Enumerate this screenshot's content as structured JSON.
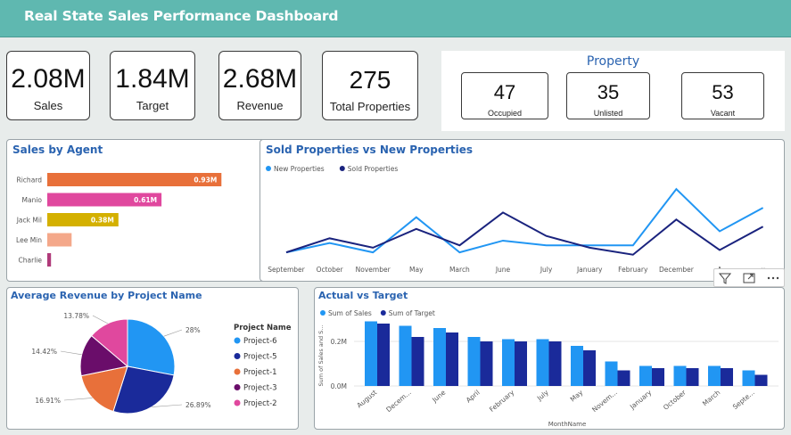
{
  "header": {
    "title": "Real State Sales Performance Dashboard"
  },
  "colors": {
    "header_bg": "#5fb8b0",
    "title_blue": "#2a63b0",
    "light_blue": "#2196f3",
    "dark_blue": "#1a237e"
  },
  "kpis": [
    {
      "value": "2.08M",
      "label": "Sales"
    },
    {
      "value": "1.84M",
      "label": "Target"
    },
    {
      "value": "2.68M",
      "label": "Revenue"
    },
    {
      "value": "275",
      "label": "Total Properties"
    }
  ],
  "property": {
    "title": "Property",
    "items": [
      {
        "value": "47",
        "label": "Occupied"
      },
      {
        "value": "35",
        "label": "Unlisted"
      },
      {
        "value": "53",
        "label": "Vacant"
      }
    ]
  },
  "sales_by_agent": {
    "title": "Sales by Agent"
  },
  "sold_vs_new": {
    "title": "Sold Properties vs New Properties"
  },
  "avg_revenue": {
    "title": "Average Revenue by Project Name",
    "legend_title": "Project Name"
  },
  "actual_vs_target": {
    "title": "Actual vs Target"
  },
  "icons": [
    "filter-icon",
    "focus-mode-icon",
    "more-options-icon"
  ],
  "chart_data": [
    {
      "id": "sales_by_agent",
      "type": "bar",
      "orientation": "horizontal",
      "categories": [
        "Richard",
        "Manio",
        "Jack Mil",
        "Lee Min",
        "Charlie"
      ],
      "values": [
        0.93,
        0.61,
        0.38,
        0.13,
        0.02
      ],
      "data_labels": [
        "0.93M",
        "0.61M",
        "0.38M",
        "",
        ""
      ],
      "colors": [
        "#e8703a",
        "#e0489e",
        "#d4b000",
        "#f4a88a",
        "#b03a7a"
      ],
      "xlim": [
        0,
        1.0
      ]
    },
    {
      "id": "sold_vs_new",
      "type": "line",
      "categories": [
        "September",
        "October",
        "November",
        "May",
        "March",
        "June",
        "July",
        "January",
        "February",
        "December",
        "April",
        "August"
      ],
      "tick_labels": [
        "September",
        "October",
        "November",
        "May",
        "March",
        "June",
        "July",
        "January",
        "February",
        "December",
        "A",
        "u"
      ],
      "series": [
        {
          "name": "New Properties",
          "color": "#2196f3",
          "values": [
            3,
            7,
            3,
            18,
            3,
            8,
            6,
            6,
            6,
            30,
            12,
            22
          ]
        },
        {
          "name": "Sold Properties",
          "color": "#1a237e",
          "values": [
            3,
            9,
            5,
            13,
            6,
            20,
            10,
            5,
            2,
            17,
            4,
            14
          ]
        }
      ],
      "ylim": [
        0,
        35
      ]
    },
    {
      "id": "avg_revenue",
      "type": "pie",
      "categories": [
        "Project-6",
        "Project-5",
        "Project-1",
        "Project-3",
        "Project-2"
      ],
      "values": [
        28.0,
        26.89,
        16.91,
        14.42,
        13.78
      ],
      "data_labels": [
        "28%",
        "26.89%",
        "16.91%",
        "14.42%",
        "13.78%"
      ],
      "colors": [
        "#2196f3",
        "#1a2a9a",
        "#e8703a",
        "#6a0d6a",
        "#e0489e"
      ],
      "legend": "right"
    },
    {
      "id": "actual_vs_target",
      "type": "bar",
      "categories": [
        "August",
        "Decem...",
        "June",
        "April",
        "February",
        "July",
        "May",
        "Novem...",
        "January",
        "October",
        "March",
        "Septe..."
      ],
      "series": [
        {
          "name": "Sum of Sales",
          "color": "#2196f3",
          "values": [
            0.29,
            0.27,
            0.26,
            0.22,
            0.21,
            0.21,
            0.18,
            0.11,
            0.09,
            0.09,
            0.09,
            0.07
          ]
        },
        {
          "name": "Sum of Target",
          "color": "#1a2a9a",
          "values": [
            0.28,
            0.22,
            0.24,
            0.2,
            0.2,
            0.2,
            0.16,
            0.07,
            0.08,
            0.08,
            0.08,
            0.05
          ]
        }
      ],
      "yticks": [
        "0.0M",
        "0.2M"
      ],
      "ylim": [
        0,
        0.3
      ],
      "xlabel": "MonthName",
      "ylabel": "Sum of Sales and S..."
    }
  ]
}
